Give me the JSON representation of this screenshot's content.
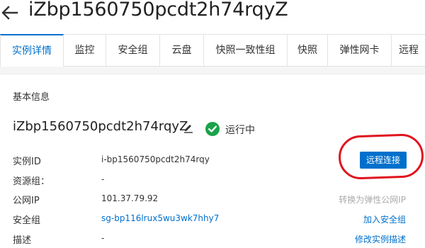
{
  "header": {
    "title": "iZbp1560750pcdt2h74rqyZ"
  },
  "tabs": [
    {
      "label": "实例详情",
      "active": true
    },
    {
      "label": "监控"
    },
    {
      "label": "安全组"
    },
    {
      "label": "云盘"
    },
    {
      "label": "快照一致性组"
    },
    {
      "label": "快照"
    },
    {
      "label": "弹性网卡"
    },
    {
      "label": "远程"
    }
  ],
  "basic_info": {
    "section_title": "基本信息",
    "instance_name": "iZbp1560750pcdt2h74rqyZ",
    "status": "运行中",
    "rows": [
      {
        "label": "实例ID",
        "value": "i-bp1560750pcdt2h74rqy"
      },
      {
        "label": "资源组：",
        "value": "-"
      },
      {
        "label": "公网IP",
        "value": "101.37.79.92"
      },
      {
        "label": "安全组",
        "value": "sg-bp116lrux5wu3wk7hhy7"
      },
      {
        "label": "描述",
        "value": "-"
      }
    ],
    "remote_connect_label": "远程连接",
    "convert_eip_label": "转换为弹性公网IP",
    "add_security_group_label": "加入安全组",
    "edit_description_label": "修改实例描述"
  },
  "colors": {
    "accent": "#0070cc",
    "status_green": "#1aa34a",
    "highlight_red": "#e0141e"
  }
}
